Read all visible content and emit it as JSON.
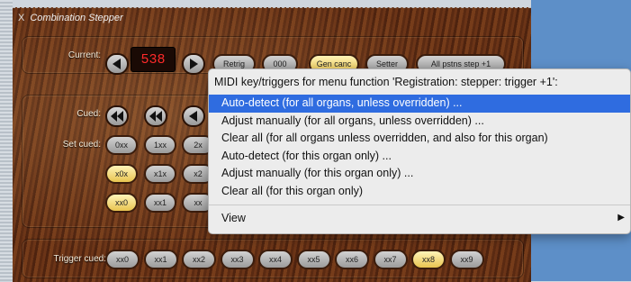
{
  "window": {
    "title": "Combination Stepper",
    "close_glyph": "X"
  },
  "current": {
    "label": "Current:",
    "counter": "538",
    "buttons": [
      "Retrig",
      "000",
      "Gen canc",
      "Setter",
      "All pstns step +1"
    ]
  },
  "cued": {
    "label": "Cued:"
  },
  "set_cued": {
    "label": "Set cued:",
    "row1": [
      "0xx",
      "1xx",
      "2x"
    ],
    "row2": [
      "x0x",
      "x1x",
      "x2"
    ],
    "row3": [
      "xx0",
      "xx1",
      "xx"
    ]
  },
  "trigger_cued": {
    "label": "Trigger cued:",
    "buttons": [
      "xx0",
      "xx1",
      "xx2",
      "xx3",
      "xx4",
      "xx5",
      "xx6",
      "xx7",
      "xx8",
      "xx9"
    ],
    "active_index": 8
  },
  "menu": {
    "header": "MIDI key/triggers for menu function 'Registration: stepper: trigger +1':",
    "items": [
      "Auto-detect (for all organs, unless overridden) ...",
      "Adjust manually (for all organs, unless overridden) ...",
      "Clear all (for all organs unless overridden, and also for this organ)",
      "Auto-detect (for this organ only) ...",
      "Adjust manually (for this organ only) ...",
      "Clear all (for this organ only)"
    ],
    "selected_index": 0,
    "view_label": "View",
    "view_arrow": "▶"
  },
  "colors": {
    "menu_highlight": "#2f6ce0",
    "counter_digits": "#ff2a2a",
    "desktop": "#5d8fc8"
  }
}
